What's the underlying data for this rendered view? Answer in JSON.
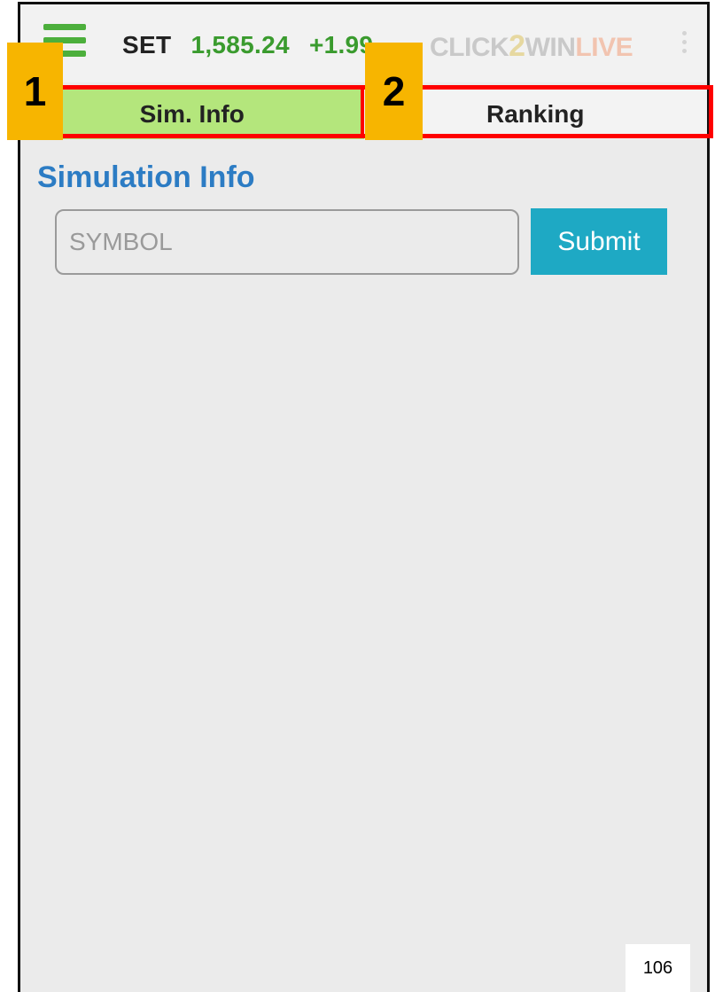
{
  "header": {
    "ticker_name": "SET",
    "ticker_price": "1,585.24",
    "ticker_change": "+1.99",
    "logo": {
      "part1": "CLICK",
      "part2": "2",
      "part3": "WIN",
      "part4": "LIVE"
    }
  },
  "tabs": [
    {
      "label": "Sim. Info",
      "active": true
    },
    {
      "label": "Ranking",
      "active": false
    }
  ],
  "main": {
    "section_title": "Simulation Info",
    "symbol_placeholder": "SYMBOL",
    "symbol_value": "",
    "submit_label": "Submit"
  },
  "annotations": {
    "badge_1": "1",
    "badge_2": "2",
    "highlight_color": "#ff0000",
    "badge_color": "#f7b500"
  },
  "colors": {
    "active_tab": "#b4e67c",
    "title_blue": "#2c7cc4",
    "submit_bg": "#1ea9c4",
    "ticker_green": "#3a9b2e"
  },
  "page_number": "106"
}
